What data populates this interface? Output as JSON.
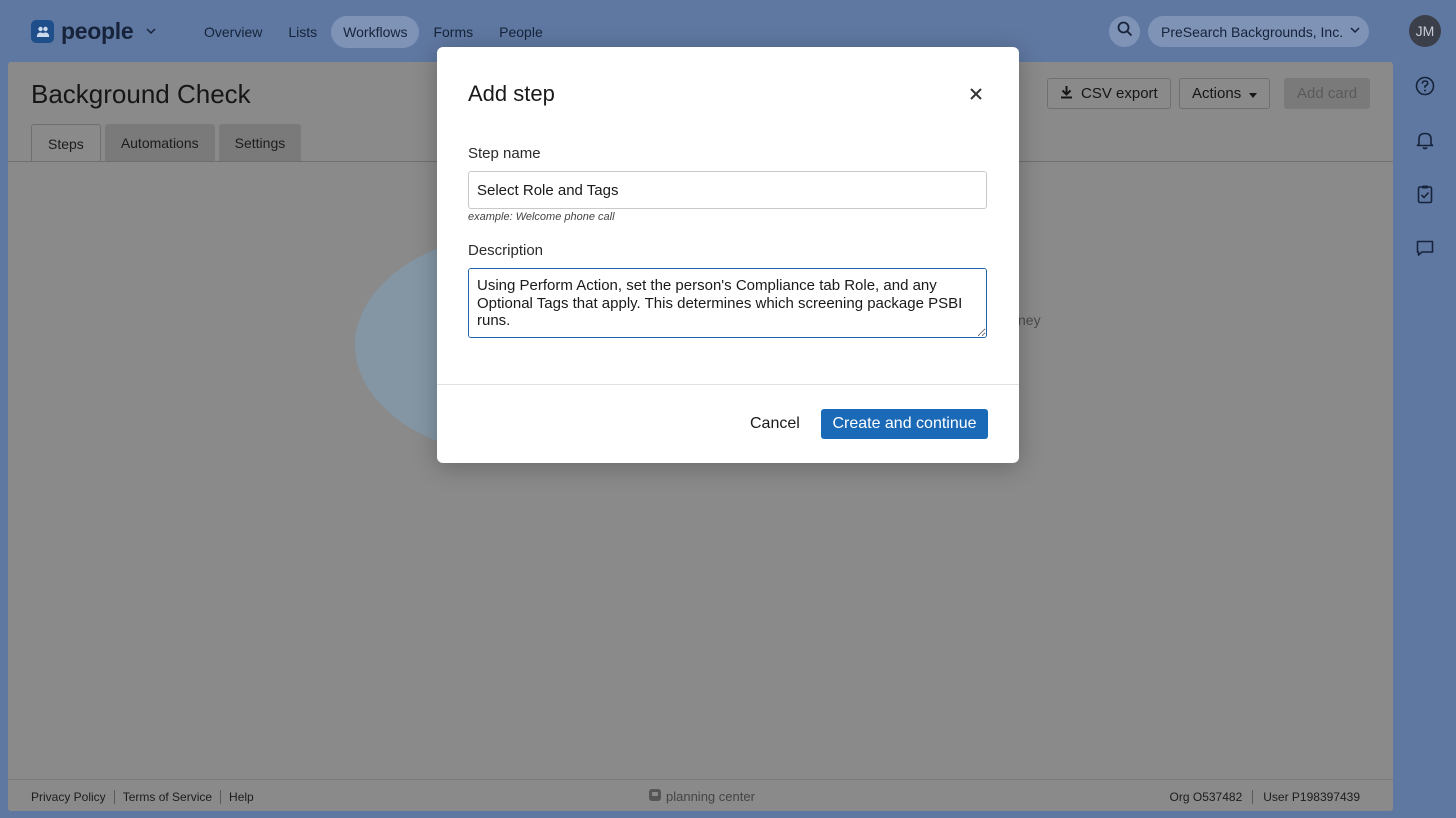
{
  "nav": {
    "brand": "people",
    "links": [
      "Overview",
      "Lists",
      "Workflows",
      "Forms",
      "People"
    ],
    "active_link": "Workflows",
    "org_name": "PreSearch Backgrounds, Inc.",
    "avatar_initials": "JM"
  },
  "page": {
    "title": "Background Check",
    "tabs": [
      "Steps",
      "Automations",
      "Settings"
    ],
    "active_tab": "Steps",
    "csv_export_label": "CSV export",
    "actions_label": "Actions",
    "add_card_label": "Add card",
    "ghost_text": "ney"
  },
  "footer": {
    "links": [
      "Privacy Policy",
      "Terms of Service",
      "Help"
    ],
    "brand": "planning center",
    "org_id": "Org O537482",
    "user_id": "User P198397439"
  },
  "modal": {
    "title": "Add step",
    "step_name_label": "Step name",
    "step_name_value": "Select Role and Tags",
    "step_name_hint": "example: Welcome phone call",
    "description_label": "Description",
    "description_value": "Using Perform Action, set the person's Compliance tab Role, and any Optional Tags that apply. This determines which screening package PSBI runs.",
    "cancel_label": "Cancel",
    "create_label": "Create and continue"
  },
  "colors": {
    "primary_button": "#1a6ab8",
    "focus_border": "#1d63b0",
    "backdrop": "#5f78a1"
  }
}
